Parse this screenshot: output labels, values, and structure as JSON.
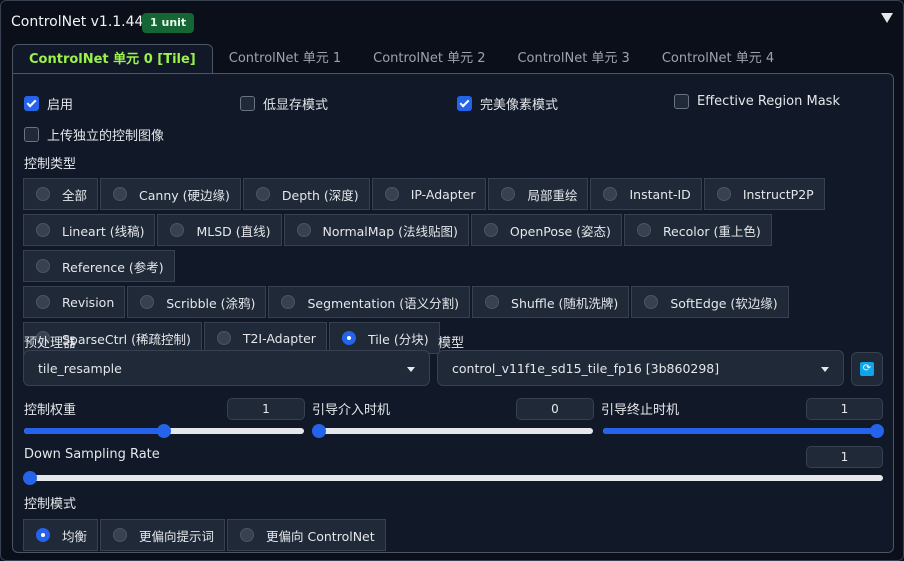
{
  "header": {
    "title": "ControlNet v1.1.449",
    "badge": "1 unit"
  },
  "tabs": [
    {
      "label": "ControlNet 单元 0 [Tile]",
      "active": true
    },
    {
      "label": "ControlNet 单元 1",
      "active": false
    },
    {
      "label": "ControlNet 单元 2",
      "active": false
    },
    {
      "label": "ControlNet 单元 3",
      "active": false
    },
    {
      "label": "ControlNet 单元 4",
      "active": false
    }
  ],
  "options": {
    "enable": {
      "label": "启用",
      "checked": true
    },
    "lowvram": {
      "label": "低显存模式",
      "checked": false
    },
    "pixel_perfect": {
      "label": "完美像素模式",
      "checked": true
    },
    "region_mask": {
      "label": "Effective Region Mask",
      "checked": false
    },
    "upload_independent": {
      "label": "上传独立的控制图像",
      "checked": false
    }
  },
  "control_type": {
    "label": "控制类型",
    "selected": "Tile (分块)",
    "rows": [
      [
        "全部",
        "Canny (硬边缘)",
        "Depth (深度)",
        "IP-Adapter",
        "局部重绘",
        "Instant-ID",
        "InstructP2P"
      ],
      [
        "Lineart (线稿)",
        "MLSD (直线)",
        "NormalMap (法线贴图)",
        "OpenPose (姿态)",
        "Recolor (重上色)",
        "Reference (参考)"
      ],
      [
        "Revision",
        "Scribble (涂鸦)",
        "Segmentation (语义分割)",
        "Shuffle (随机洗牌)",
        "SoftEdge (软边缘)"
      ],
      [
        "SparseCtrl (稀疏控制)",
        "T2I-Adapter",
        "Tile (分块)"
      ]
    ]
  },
  "preprocessor": {
    "label": "预处理器",
    "value": "tile_resample"
  },
  "model": {
    "label": "模型",
    "value": "control_v11f1e_sd15_tile_fp16 [3b860298]",
    "refresh_icon": "refresh-icon"
  },
  "sliders": {
    "weight": {
      "label": "控制权重",
      "value": "1",
      "fraction": 0.5
    },
    "start": {
      "label": "引导介入时机",
      "value": "0",
      "fraction": 0.0
    },
    "end": {
      "label": "引导终止时机",
      "value": "1",
      "fraction": 1.0
    },
    "down_sampling": {
      "label": "Down Sampling Rate",
      "value": "1",
      "fraction": 0.0
    }
  },
  "control_mode": {
    "label": "控制模式",
    "options": [
      "均衡",
      "更偏向提示词",
      "更偏向 ControlNet"
    ],
    "selected": "均衡"
  },
  "colors": {
    "accent": "#2563eb",
    "active_tab": "#9df24a",
    "badge_bg": "#166534"
  }
}
